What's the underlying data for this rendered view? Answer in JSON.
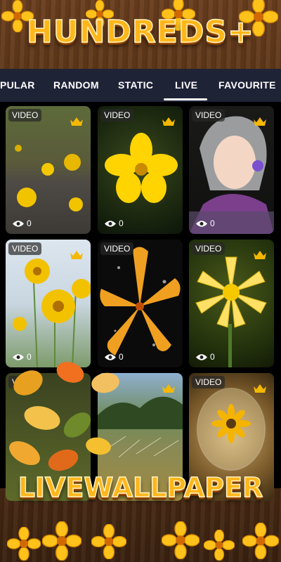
{
  "header": {
    "title": "HUNDREDS+"
  },
  "tabs": [
    {
      "label": "PULAR",
      "active": false
    },
    {
      "label": "RANDOM",
      "active": false
    },
    {
      "label": "STATIC",
      "active": false
    },
    {
      "label": "LIVE",
      "active": true
    },
    {
      "label": "FAVOURITE",
      "active": false
    }
  ],
  "cards": [
    {
      "badge": "VIDEO",
      "views": "0",
      "premium": true
    },
    {
      "badge": "VIDEO",
      "views": "0",
      "premium": true
    },
    {
      "badge": "VIDEO",
      "views": "0",
      "premium": true
    },
    {
      "badge": "VIDEO",
      "views": "0",
      "premium": true
    },
    {
      "badge": "VIDEO",
      "views": "0",
      "premium": false
    },
    {
      "badge": "VIDEO",
      "views": "0",
      "premium": true
    },
    {
      "badge": "VIDEO",
      "views": "",
      "premium": false
    },
    {
      "badge": "",
      "views": "",
      "premium": true
    },
    {
      "badge": "VIDEO",
      "views": "",
      "premium": true
    }
  ],
  "footer": {
    "title": "LIVEWALLPAPER"
  },
  "colors": {
    "accent": "#ffb61a",
    "tabbar": "#1f2336",
    "wood": "#5a3418"
  },
  "icons": [
    "crown-icon",
    "eye-icon",
    "flower-icon"
  ]
}
